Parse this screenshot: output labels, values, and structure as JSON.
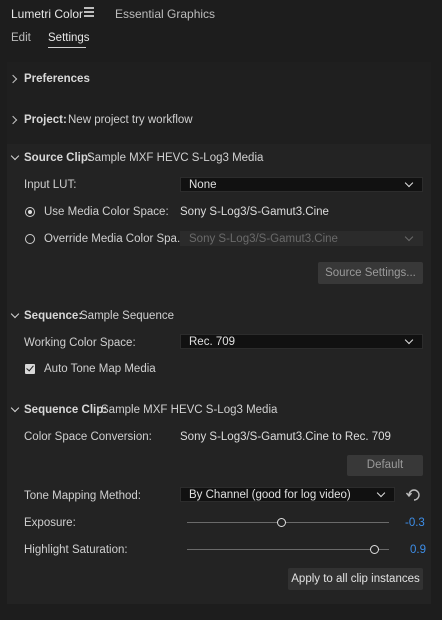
{
  "tabs": {
    "lumetri": "Lumetri Color",
    "essential": "Essential Graphics"
  },
  "subtabs": {
    "edit": "Edit",
    "settings": "Settings"
  },
  "preferences": {
    "title": "Preferences"
  },
  "project": {
    "title": "Project:",
    "value": "New project try workflow"
  },
  "source_clip": {
    "title": "Source Clip:",
    "value": "Sample MXF HEVC S-Log3 Media",
    "input_lut_label": "Input LUT:",
    "input_lut_value": "None",
    "use_media_label": "Use Media Color Space:",
    "use_media_value": "Sony S-Log3/S-Gamut3.Cine",
    "override_label": "Override Media Color Spa...",
    "override_value": "Sony S-Log3/S-Gamut3.Cine",
    "source_settings_button": "Source Settings..."
  },
  "sequence": {
    "title": "Sequence:",
    "value": "Sample Sequence",
    "working_label": "Working Color Space:",
    "working_value": "Rec. 709",
    "auto_tone_label": "Auto Tone Map Media",
    "auto_tone_checked": true
  },
  "sequence_clip": {
    "title": "Sequence Clip:",
    "value": "Sample MXF HEVC S-Log3 Media",
    "conversion_label": "Color Space Conversion:",
    "conversion_value": "Sony S-Log3/S-Gamut3.Cine to Rec. 709",
    "default_button": "Default",
    "tone_mapping_label": "Tone Mapping Method:",
    "tone_mapping_value": "By Channel (good for log video)",
    "exposure_label": "Exposure:",
    "exposure_value": "-0.3",
    "exposure_fraction": 0.47,
    "highlight_label": "Highlight Saturation:",
    "highlight_value": "0.9",
    "highlight_fraction": 0.93,
    "apply_button": "Apply to all clip instances"
  },
  "colors": {
    "background": "#1d1d1d",
    "panel": "#232323",
    "accent_value": "#3d8ee8"
  }
}
